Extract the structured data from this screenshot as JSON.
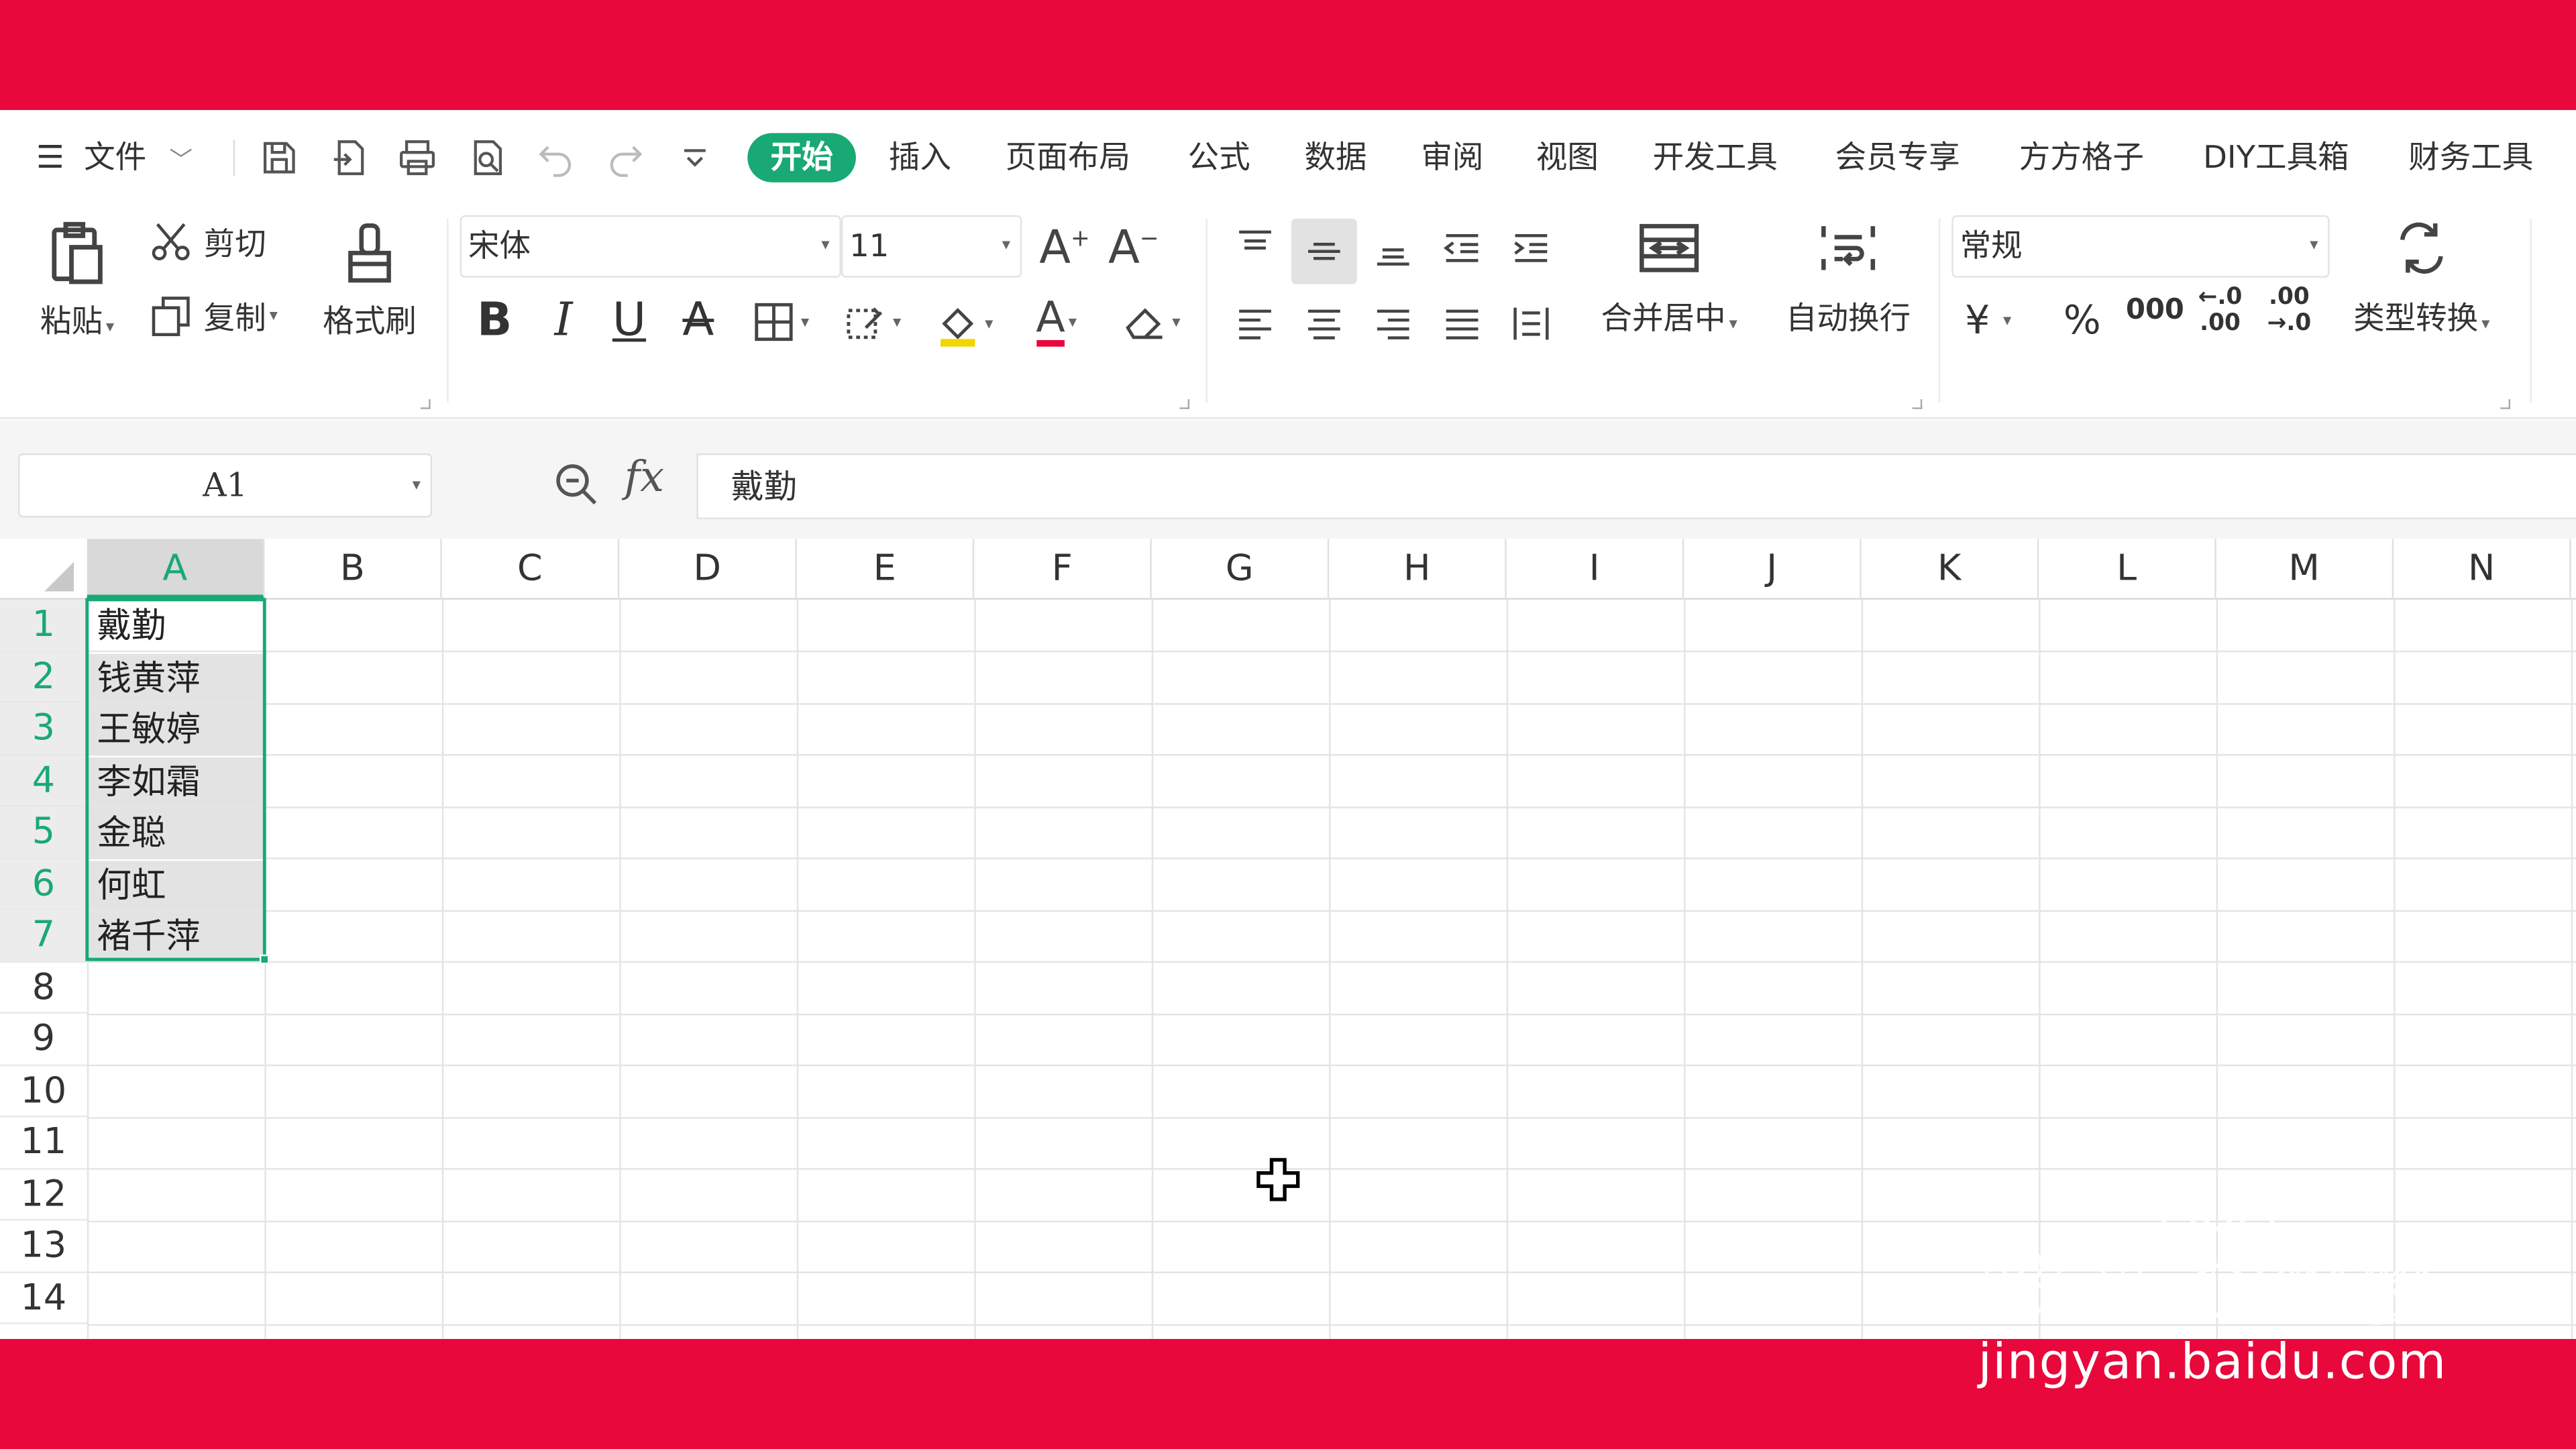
{
  "menubar": {
    "file_menu": "文件",
    "tabs": [
      "开始",
      "插入",
      "页面布局",
      "公式",
      "数据",
      "审阅",
      "视图",
      "开发工具",
      "会员专享",
      "方方格子",
      "DIY工具箱",
      "财务工具"
    ],
    "active_tab": "开始"
  },
  "ribbon": {
    "paste": "粘贴",
    "cut": "剪切",
    "copy": "复制",
    "format_painter": "格式刷",
    "font_name": "宋体",
    "font_size": "11",
    "merge_center": "合并居中",
    "wrap_text": "自动换行",
    "number_format": "常规",
    "type_convert": "类型转换",
    "currency_symbol": "¥",
    "percent_symbol": "%",
    "thousands_symbol": "000"
  },
  "formula_bar": {
    "name_box": "A1",
    "fx": "fx",
    "content": "戴勤"
  },
  "sheet": {
    "columns": [
      "A",
      "B",
      "C",
      "D",
      "E",
      "F",
      "G",
      "H",
      "I",
      "J",
      "K",
      "L",
      "M",
      "N"
    ],
    "rows": [
      "1",
      "2",
      "3",
      "4",
      "5",
      "6",
      "7",
      "8",
      "9",
      "10",
      "11",
      "12",
      "13",
      "14"
    ],
    "column_a_values": [
      "戴勤",
      "钱黄萍",
      "王敏婷",
      "李如霜",
      "金聪",
      "何虹",
      "褚千萍"
    ],
    "selected_range": "A1:A7"
  },
  "watermark": {
    "url": "jingyan.baidu.com"
  },
  "colors": {
    "frame_red": "#e8083b",
    "accent_green": "#19a974",
    "selection_fill": "#e3e3e3"
  }
}
